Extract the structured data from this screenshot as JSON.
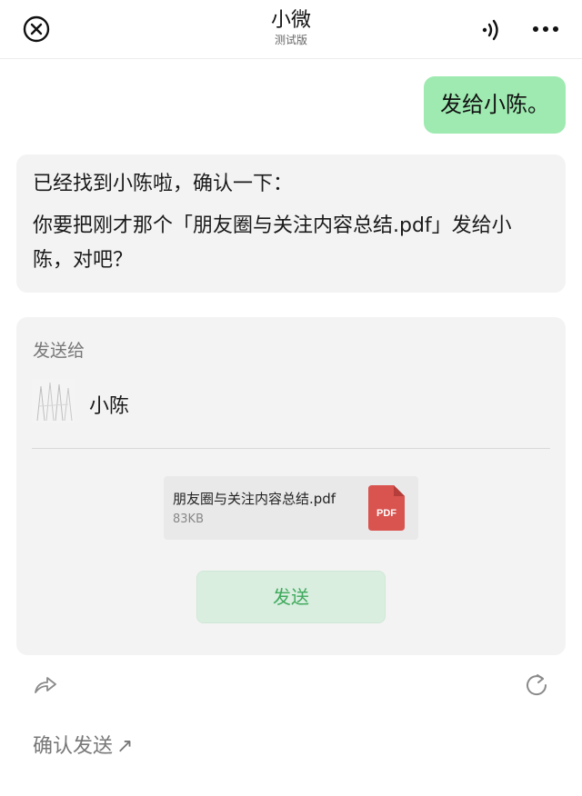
{
  "header": {
    "title": "小微",
    "subtitle": "测试版",
    "close_icon": "close-circle-icon",
    "sound_icon": "sound-wave-icon",
    "more_icon": "more-dots-icon"
  },
  "messages": {
    "user_text": "发给小陈。",
    "bot_lines": [
      "已经找到小陈啦，确认一下：",
      "你要把刚才那个「朋友圈与关注内容总结.pdf」发给小陈，对吧？"
    ]
  },
  "send_card": {
    "label": "发送给",
    "contact_name": "小陈",
    "file": {
      "name": "朋友圈与关注内容总结.pdf",
      "size": "83KB",
      "type_badge": "PDF"
    },
    "send_label": "发送"
  },
  "actions": {
    "share_icon": "share-arrow-icon",
    "refresh_icon": "refresh-icon"
  },
  "footer": {
    "confirm_label": "确认发送",
    "confirm_arrow": "↗"
  },
  "colors": {
    "user_bubble": "#9eeab0",
    "bot_bubble": "#f3f3f3",
    "send_text": "#3fa95c",
    "pdf_red": "#d9534f"
  }
}
